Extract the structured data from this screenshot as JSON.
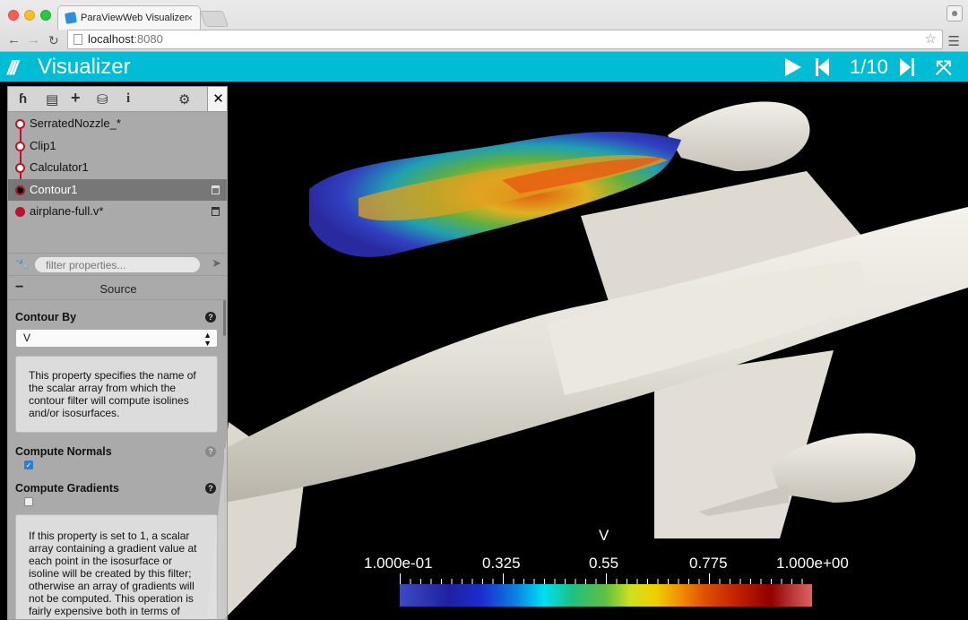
{
  "browser": {
    "tab_title": "ParaViewWeb Visualizer",
    "tab_close": "×",
    "url_host": "localhost",
    "url_port": ":8080",
    "icons": [
      "back-arrow-icon",
      "forward-arrow-icon",
      "reload-icon",
      "page-icon",
      "star-icon",
      "menu-icon",
      "user-icon"
    ]
  },
  "header": {
    "logo": "///",
    "title": "Visualizer",
    "frame_counter": "1/10",
    "fullscreen": "⤧",
    "accent_color": "#00bcd4"
  },
  "toolbar": {
    "icons": [
      "pipeline-icon",
      "file-icon",
      "add-filter-icon",
      "save-icon",
      "info-icon",
      "settings-icon",
      "collapse-icon"
    ],
    "glyphs": {
      "pipeline": "ɦ",
      "file": "▤",
      "add": "+",
      "save": "⛁",
      "info": "i",
      "settings": "⚙",
      "collapse": "✕"
    }
  },
  "pipeline": {
    "items": [
      {
        "label": "SerratedNozzle_*"
      },
      {
        "label": "Clip1"
      },
      {
        "label": "Calculator1"
      },
      {
        "label": "Contour1"
      },
      {
        "label": "airplane-full.v*"
      }
    ],
    "active_index": 3
  },
  "filter": {
    "placeholder": "filter properties..."
  },
  "properties": {
    "collapse_glyph": "−",
    "section_title": "Source",
    "contour_by_label": "Contour By",
    "contour_by_value": "V",
    "contour_by_help": "This property specifies the name of the scalar array from which the contour filter will compute isolines and/or isosurfaces.",
    "compute_normals_label": "Compute Normals",
    "compute_normals_checked": true,
    "compute_gradients_label": "Compute Gradients",
    "compute_gradients_checked": false,
    "compute_gradients_help": "If this property is set to 1, a scalar array containing a gradient value at each point in the isosurface or isoline will be created by this filter; otherwise an array of gradients will not be computed. This operation is fairly expensive both in terms of",
    "help_glyph": "?",
    "check_glyph": "✓",
    "caret_glyph": "▲▼"
  },
  "colorbar": {
    "title": "V",
    "labels": [
      "1.000e-01",
      "0.325",
      "0.55",
      "0.775",
      "1.000e+00"
    ]
  }
}
